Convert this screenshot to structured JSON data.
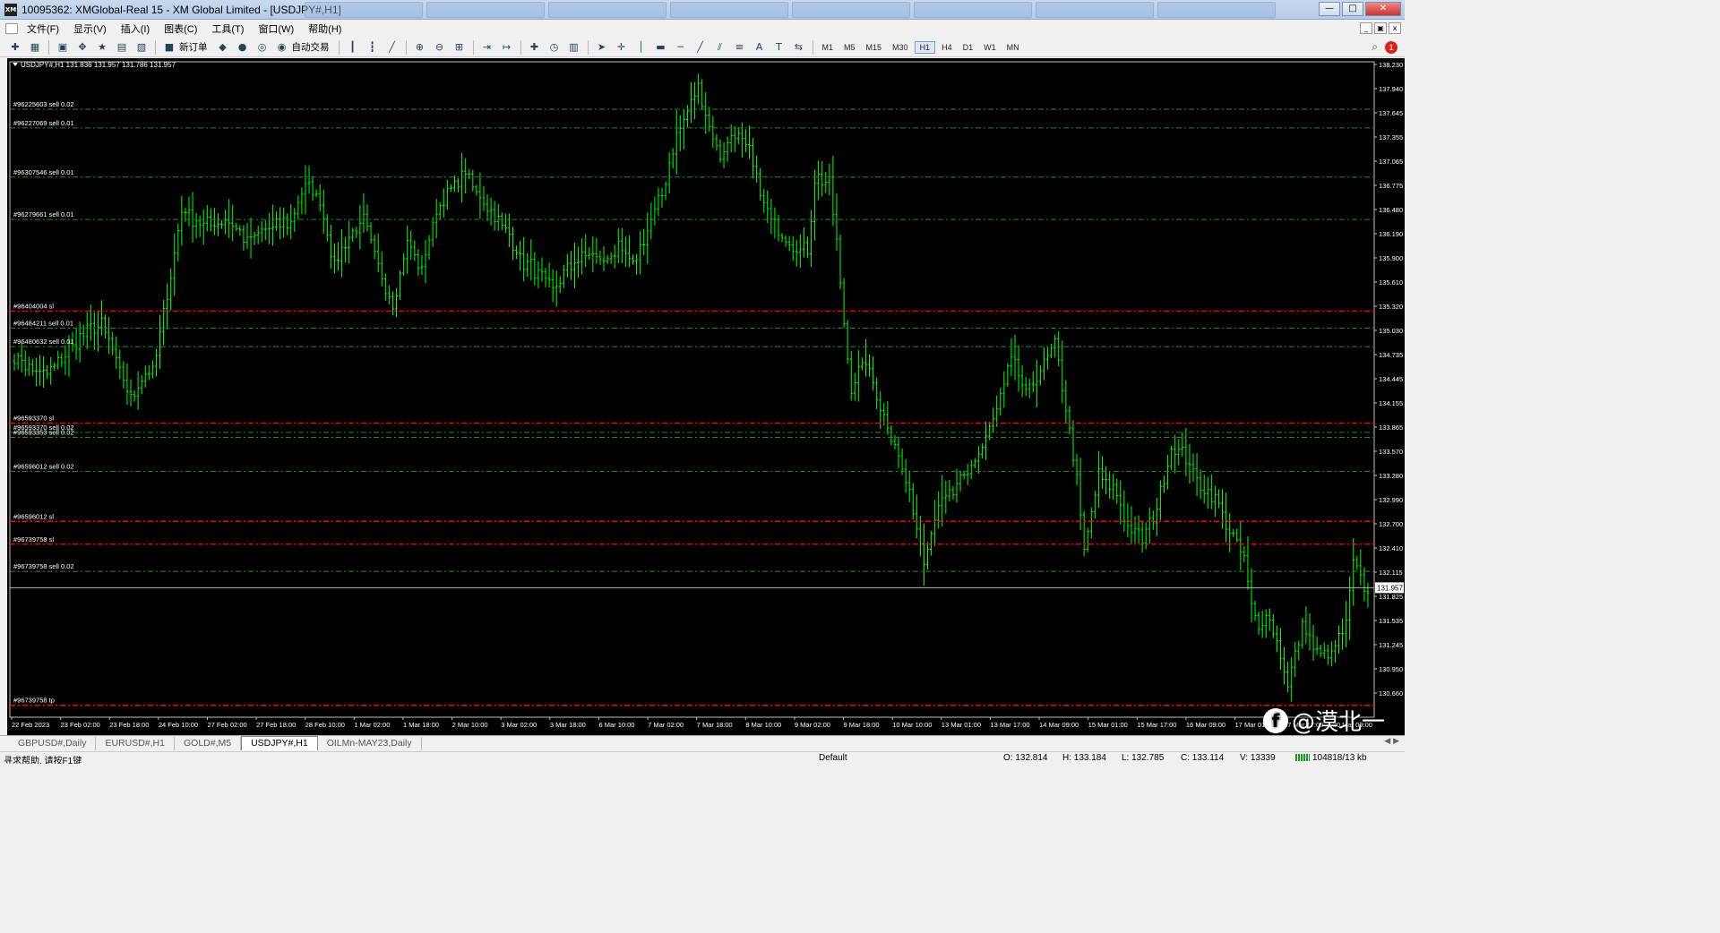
{
  "window": {
    "title": "10095362: XMGlobal-Real 15 - XM Global Limited - [USDJPY#,H1]",
    "app_icon": "XM",
    "min_label": "—",
    "max_label": "□",
    "close_label": "✕"
  },
  "menu": {
    "items": [
      {
        "label": "文件(F)"
      },
      {
        "label": "显示(V)"
      },
      {
        "label": "插入(I)"
      },
      {
        "label": "图表(C)"
      },
      {
        "label": "工具(T)"
      },
      {
        "label": "窗口(W)"
      },
      {
        "label": "帮助(H)"
      }
    ],
    "mdi_min": "_",
    "mdi_restore": "▣",
    "mdi_close": "x"
  },
  "toolbar": {
    "new_order_label": "新订单",
    "auto_trading_label": "自动交易",
    "timeframes": [
      "M1",
      "M5",
      "M15",
      "M30",
      "H1",
      "H4",
      "D1",
      "W1",
      "MN"
    ],
    "active_timeframe": "H1",
    "alert_count": "1"
  },
  "chart_data": {
    "type": "ohlc",
    "header": "USDJPY#,H1  131.836 131.957 131.786 131.957",
    "symbol": "USDJPY#",
    "timeframe": "H1",
    "ylim": [
      130.43,
      138.16
    ],
    "y_ticks": [
      "138.230",
      "137.940",
      "137.645",
      "137.355",
      "137.065",
      "136.775",
      "136.480",
      "136.190",
      "135.900",
      "135.610",
      "135.320",
      "135.030",
      "134.735",
      "134.445",
      "134.155",
      "133.865",
      "133.570",
      "133.280",
      "132.990",
      "132.700",
      "132.410",
      "132.115",
      "131.825",
      "131.535",
      "131.245",
      "130.950",
      "130.660"
    ],
    "x_labels": [
      "22 Feb 2023",
      "23 Feb 02:00",
      "23 Feb 18:00",
      "24 Feb 10:00",
      "27 Feb 02:00",
      "27 Feb 18:00",
      "28 Feb 10:00",
      "1 Mar 02:00",
      "1 Mar 18:00",
      "2 Mar 10:00",
      "3 Mar 02:00",
      "3 Mar 18:00",
      "6 Mar 10:00",
      "7 Mar 02:00",
      "7 Mar 18:00",
      "8 Mar 10:00",
      "9 Mar 02:00",
      "9 Mar 18:00",
      "10 Mar 10:00",
      "13 Mar 01:00",
      "13 Mar 17:00",
      "14 Mar 09:00",
      "15 Mar 01:00",
      "15 Mar 17:00",
      "16 Mar 09:00",
      "17 Mar 01:00",
      "17 Mar 17:00",
      "20 Mar 09:00"
    ],
    "current_price": "131.957",
    "current_price_value": 131.957,
    "bar_color": "#00ff00",
    "background": "#000000",
    "sell_line_color": "#228b22",
    "sl_line_color": "#ff0000",
    "anchor_points": [
      [
        0,
        134.7
      ],
      [
        8,
        134.45
      ],
      [
        15,
        134.78
      ],
      [
        20,
        134.98
      ],
      [
        24,
        135.08
      ],
      [
        28,
        134.62
      ],
      [
        32,
        134.18
      ],
      [
        36,
        134.52
      ],
      [
        38,
        134.48
      ],
      [
        42,
        135.4
      ],
      [
        46,
        136.42
      ],
      [
        52,
        136.22
      ],
      [
        58,
        136.3
      ],
      [
        64,
        136.05
      ],
      [
        70,
        136.2
      ],
      [
        76,
        136.28
      ],
      [
        80,
        136.72
      ],
      [
        84,
        136.55
      ],
      [
        88,
        135.72
      ],
      [
        92,
        136.1
      ],
      [
        96,
        136.28
      ],
      [
        100,
        135.75
      ],
      [
        104,
        135.3
      ],
      [
        108,
        136.05
      ],
      [
        112,
        135.72
      ],
      [
        116,
        136.4
      ],
      [
        120,
        136.65
      ],
      [
        124,
        136.86
      ],
      [
        128,
        136.55
      ],
      [
        132,
        136.35
      ],
      [
        136,
        136.1
      ],
      [
        140,
        135.8
      ],
      [
        144,
        135.68
      ],
      [
        148,
        135.45
      ],
      [
        150,
        135.62
      ],
      [
        154,
        135.8
      ],
      [
        158,
        135.92
      ],
      [
        162,
        135.8
      ],
      [
        166,
        135.95
      ],
      [
        170,
        135.75
      ],
      [
        174,
        136.15
      ],
      [
        178,
        136.62
      ],
      [
        182,
        137.3
      ],
      [
        186,
        137.68
      ],
      [
        188,
        137.86
      ],
      [
        191,
        137.42
      ],
      [
        194,
        137.02
      ],
      [
        198,
        137.35
      ],
      [
        202,
        137.08
      ],
      [
        206,
        136.45
      ],
      [
        210,
        136.15
      ],
      [
        214,
        136.02
      ],
      [
        218,
        135.9
      ],
      [
        220,
        136.8
      ],
      [
        224,
        136.75
      ],
      [
        226,
        136.02
      ],
      [
        228,
        135.05
      ],
      [
        230,
        134.35
      ],
      [
        234,
        134.62
      ],
      [
        238,
        134.08
      ],
      [
        242,
        133.65
      ],
      [
        246,
        133.08
      ],
      [
        250,
        132.28
      ],
      [
        254,
        132.95
      ],
      [
        258,
        133.1
      ],
      [
        262,
        133.3
      ],
      [
        266,
        133.62
      ],
      [
        270,
        134.05
      ],
      [
        274,
        134.65
      ],
      [
        278,
        134.25
      ],
      [
        282,
        134.55
      ],
      [
        286,
        134.82
      ],
      [
        288,
        134.35
      ],
      [
        292,
        133.2
      ],
      [
        294,
        132.38
      ],
      [
        298,
        133.28
      ],
      [
        302,
        133.12
      ],
      [
        306,
        132.7
      ],
      [
        310,
        132.52
      ],
      [
        314,
        132.88
      ],
      [
        318,
        133.6
      ],
      [
        322,
        133.5
      ],
      [
        326,
        133.15
      ],
      [
        330,
        133.05
      ],
      [
        334,
        132.62
      ],
      [
        338,
        132.3
      ],
      [
        340,
        131.72
      ],
      [
        342,
        131.42
      ],
      [
        344,
        131.7
      ],
      [
        348,
        131.18
      ],
      [
        350,
        130.78
      ],
      [
        354,
        131.52
      ],
      [
        358,
        131.2
      ],
      [
        362,
        131.15
      ],
      [
        366,
        131.55
      ],
      [
        368,
        132.25
      ],
      [
        370,
        132.05
      ],
      [
        372,
        131.85
      ]
    ],
    "total_bars": 373,
    "order_lines": [
      {
        "label": "#96225603 sell 0.02",
        "price": 137.6,
        "kind": "sell"
      },
      {
        "label": "#96227069 sell 0.01",
        "price": 137.38,
        "kind": "sell"
      },
      {
        "label": "#96307546 sell 0.01",
        "price": 136.8,
        "kind": "sell"
      },
      {
        "label": "#96279661 sell 0.01",
        "price": 136.3,
        "kind": "sell"
      },
      {
        "label": "#96404004 sl",
        "price": 135.22,
        "kind": "sl"
      },
      {
        "label": "#96484211 sell 0.01",
        "price": 135.02,
        "kind": "sell"
      },
      {
        "label": "#96480632 sell 0.01",
        "price": 134.8,
        "kind": "sell"
      },
      {
        "label": "#96593370 sl",
        "price": 133.9,
        "kind": "sl"
      },
      {
        "label": "#96593370 sell 0.02",
        "price": 133.79,
        "kind": "sell"
      },
      {
        "label": "#96593353 sell 0.02",
        "price": 133.73,
        "kind": "sell"
      },
      {
        "label": "#96596012 sell 0.02",
        "price": 133.33,
        "kind": "sell"
      },
      {
        "label": "#96596012 sl",
        "price": 132.74,
        "kind": "sl"
      },
      {
        "label": "#96739758 sl",
        "price": 132.47,
        "kind": "sl"
      },
      {
        "label": "#96739758 sell 0.02",
        "price": 132.15,
        "kind": "sell"
      },
      {
        "label": "#96739758 tp",
        "price": 130.57,
        "kind": "sl"
      }
    ]
  },
  "tabs": [
    {
      "label": "GBPUSD#,Daily"
    },
    {
      "label": "EURUSD#,H1"
    },
    {
      "label": "GOLD#,M5"
    },
    {
      "label": "USDJPY#,H1",
      "active": true
    },
    {
      "label": "OILMn-MAY23,Daily"
    }
  ],
  "tab_nav": "◀ ▶",
  "status": {
    "help": "寻求帮助, 请按F1键",
    "profile": "Default",
    "open": "O: 132.814",
    "high": "H: 133.184",
    "low": "L: 132.785",
    "close": "C: 133.114",
    "volume": "V: 13339",
    "traffic": "104818/13 kb"
  },
  "watermark": {
    "logo": "f",
    "text": "@漠北一"
  }
}
